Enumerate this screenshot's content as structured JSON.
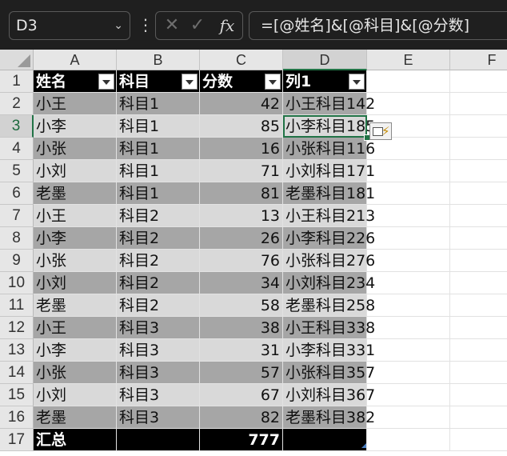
{
  "formula_bar": {
    "name_box": "D3",
    "name_box_icon": "chevron-down-icon",
    "more_icon": "vertical-dots-icon",
    "cancel_icon": "close-icon",
    "enter_icon": "check-icon",
    "function_icon": "fx-icon",
    "fx_label": "fx",
    "formula": "=[@姓名]&[@科目]&[@分数]"
  },
  "sheet": {
    "columns": [
      "A",
      "B",
      "C",
      "D",
      "E",
      "F"
    ],
    "rows": [
      "1",
      "2",
      "3",
      "4",
      "5",
      "6",
      "7",
      "8",
      "9",
      "10",
      "11",
      "12",
      "13",
      "14",
      "15",
      "16",
      "17"
    ],
    "selected_column": "D",
    "selected_row": "3",
    "table": {
      "headers": [
        "姓名",
        "科目",
        "分数",
        "列1"
      ],
      "data": [
        [
          "小王",
          "科目1",
          "42",
          "小王科目142"
        ],
        [
          "小李",
          "科目1",
          "85",
          "小李科目185"
        ],
        [
          "小张",
          "科目1",
          "16",
          "小张科目116"
        ],
        [
          "小刘",
          "科目1",
          "71",
          "小刘科目171"
        ],
        [
          "老墨",
          "科目1",
          "81",
          "老墨科目181"
        ],
        [
          "小王",
          "科目2",
          "13",
          "小王科目213"
        ],
        [
          "小李",
          "科目2",
          "26",
          "小李科目226"
        ],
        [
          "小张",
          "科目2",
          "76",
          "小张科目276"
        ],
        [
          "小刘",
          "科目2",
          "34",
          "小刘科目234"
        ],
        [
          "老墨",
          "科目2",
          "58",
          "老墨科目258"
        ],
        [
          "小王",
          "科目3",
          "38",
          "小王科目338"
        ],
        [
          "小李",
          "科目3",
          "31",
          "小李科目331"
        ],
        [
          "小张",
          "科目3",
          "57",
          "小张科目357"
        ],
        [
          "小刘",
          "科目3",
          "67",
          "小刘科目367"
        ],
        [
          "老墨",
          "科目3",
          "82",
          "老墨科目382"
        ]
      ],
      "total_label": "汇总",
      "total_value": "777"
    },
    "autofill_icon": "flash-fill-icon",
    "colors": {
      "header_fill": "#000000",
      "band_dark": "#a6a6a6",
      "band_light": "#d9d9d9",
      "selection": "#217346"
    }
  }
}
